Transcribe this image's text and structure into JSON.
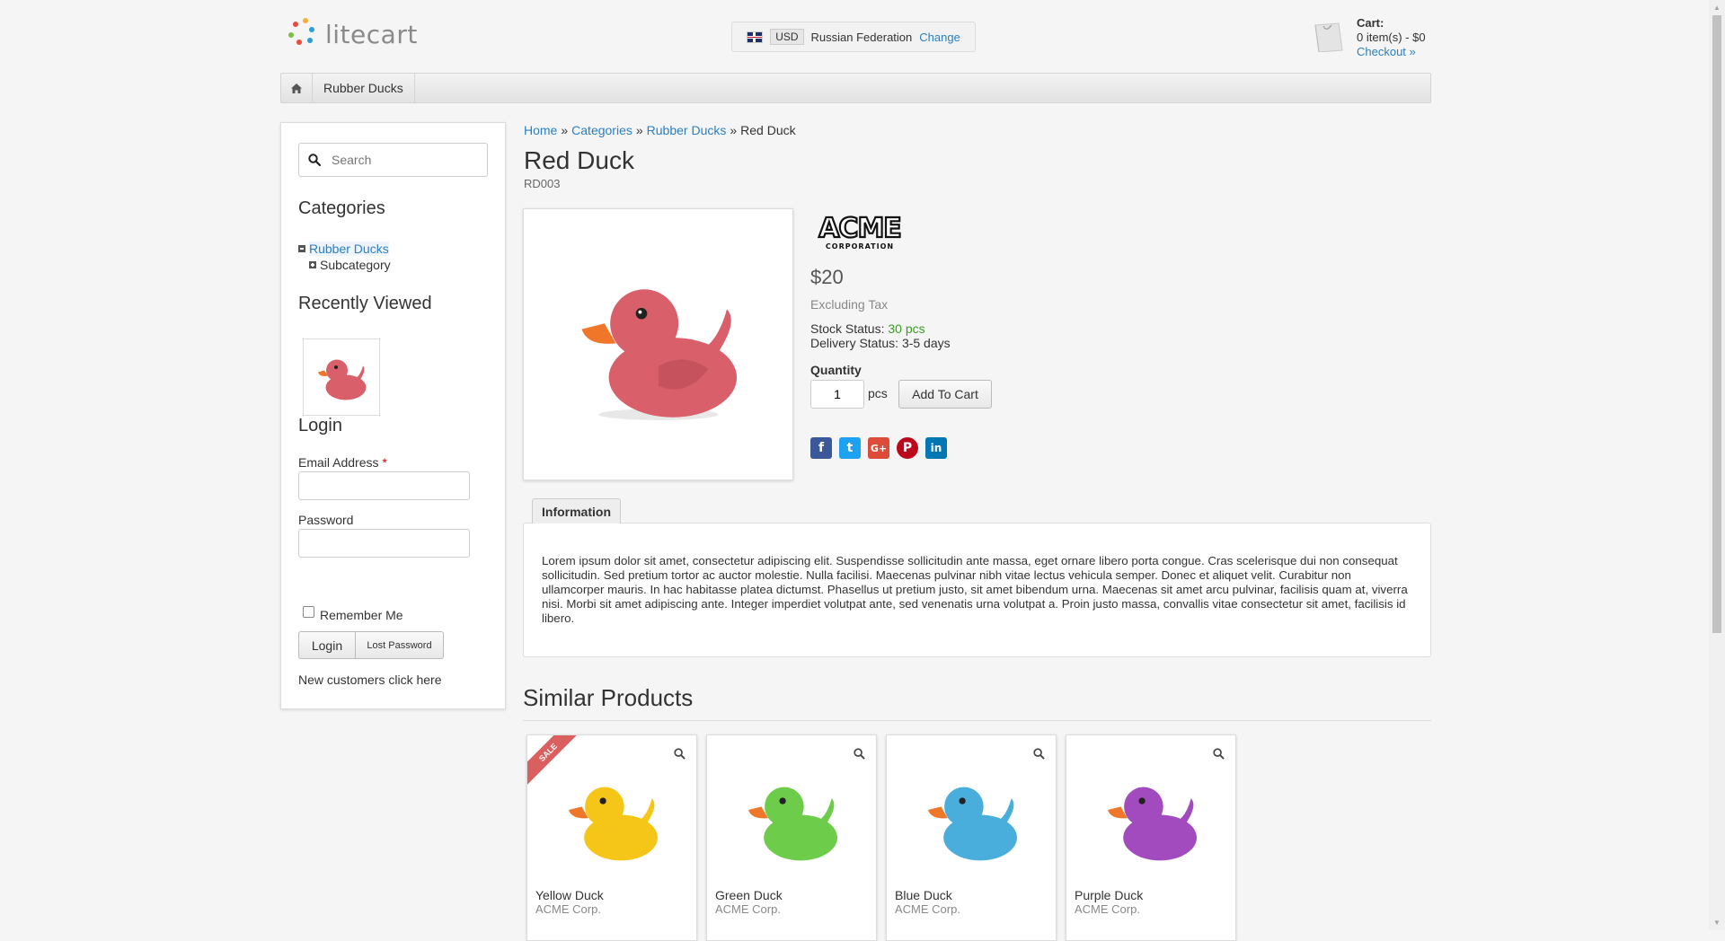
{
  "header": {
    "logo_text": "litecart",
    "region": {
      "currency": "USD",
      "country": "Russian Federation",
      "change_label": "Change"
    },
    "cart": {
      "title": "Cart:",
      "summary": "0 item(s) - $0",
      "checkout_label": "Checkout »"
    }
  },
  "nav": {
    "items": [
      "Rubber Ducks"
    ]
  },
  "sidebar": {
    "search_placeholder": "Search",
    "categories_heading": "Categories",
    "categories": [
      {
        "label": "Rubber Ducks",
        "expanded": true
      },
      {
        "label": "Subcategory",
        "expanded": false
      }
    ],
    "recently_viewed_heading": "Recently Viewed",
    "login": {
      "heading": "Login",
      "email_label": "Email Address",
      "required_mark": "*",
      "password_label": "Password",
      "remember_label": "Remember Me",
      "login_button": "Login",
      "lost_password_button": "Lost Password",
      "new_customers_link": "New customers click here"
    }
  },
  "breadcrumb": {
    "items": [
      "Home",
      "Categories",
      "Rubber Ducks"
    ],
    "current": "Red Duck",
    "separator": "»"
  },
  "product": {
    "name": "Red Duck",
    "sku": "RD003",
    "manufacturer_logo": "ACME CORPORATION",
    "price": "$20",
    "tax_note": "Excluding Tax",
    "stock_label": "Stock Status:",
    "stock_value": "30 pcs",
    "delivery_label": "Delivery Status:",
    "delivery_value": "3-5 days",
    "quantity_label": "Quantity",
    "quantity_value": "1",
    "quantity_unit": "pcs",
    "add_to_cart_label": "Add To Cart",
    "color": "#d9606a",
    "share_icons": [
      "facebook-icon",
      "twitter-icon",
      "google-plus-icon",
      "pinterest-icon",
      "linkedin-icon"
    ]
  },
  "tabs": {
    "information_label": "Information",
    "information_text": "Lorem ipsum dolor sit amet, consectetur adipiscing elit. Suspendisse sollicitudin ante massa, eget ornare libero porta congue. Cras scelerisque dui non consequat sollicitudin. Sed pretium tortor ac auctor molestie. Nulla facilisi. Maecenas pulvinar nibh vitae lectus vehicula semper. Donec et aliquet velit. Curabitur non ullamcorper mauris. In hac habitasse platea dictumst. Phasellus ut pretium justo, sit amet bibendum urna. Maecenas sit amet arcu pulvinar, facilisis quam at, viverra nisi. Morbi sit amet adipiscing ante. Integer imperdiet volutpat ante, sed venenatis urna volutpat a. Proin justo massa, convallis vitae consectetur sit amet, facilisis id libero."
  },
  "similar": {
    "heading": "Similar Products",
    "products": [
      {
        "name": "Yellow Duck",
        "manufacturer": "ACME Corp.",
        "sale_badge": "SALE",
        "color": "#f5c518"
      },
      {
        "name": "Green Duck",
        "manufacturer": "ACME Corp.",
        "color": "#6dcc4a"
      },
      {
        "name": "Blue Duck",
        "manufacturer": "ACME Corp.",
        "color": "#4aaedc"
      },
      {
        "name": "Purple Duck",
        "manufacturer": "ACME Corp.",
        "color": "#a24bbf"
      }
    ]
  },
  "colors": {
    "link": "#2a7fc1",
    "stock_green": "#3a9d23",
    "sale_red": "#d9605f"
  }
}
